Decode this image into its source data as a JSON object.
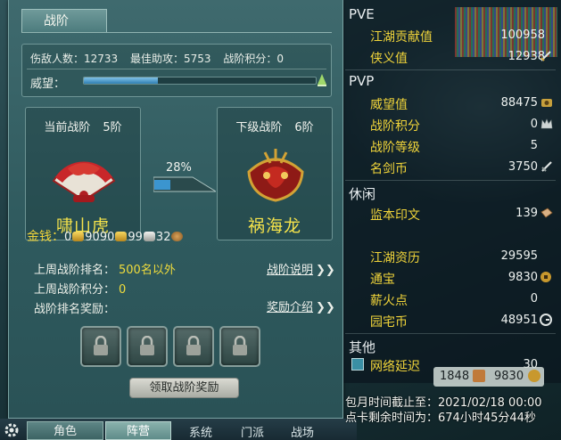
{
  "panel": {
    "tab_title": "战阶",
    "stats": {
      "kills": "伤敌人数：12733",
      "best_assist": "最佳助攻：5753",
      "points": "战阶积分：0"
    },
    "prestige_label": "威望：",
    "prestige_progress": 0.32,
    "current": {
      "header": "当前战阶",
      "rank": "5阶",
      "name": "啸山虎"
    },
    "next": {
      "header": "下级战阶",
      "rank": "6阶",
      "name": "祸海龙"
    },
    "progress_percent": "28%",
    "rows": {
      "last_week_rank_label": "上周战阶排名：",
      "last_week_rank_value": "500名以外",
      "last_week_points_label": "上周战阶积分：",
      "last_week_points_value": "0",
      "reward_label": "战阶排名奖励："
    },
    "links": {
      "description": "战阶说明",
      "rewards_intro": "奖励介绍"
    },
    "claim_button": "领取战阶奖励"
  },
  "bottom_tabs": {
    "character": "角色",
    "camp": "阵营",
    "system": "系统",
    "sect": "门派",
    "battlefield": "战场"
  },
  "right": {
    "pve_title": "PVE",
    "pve": [
      {
        "label": "江湖贡献值",
        "value": "100958"
      },
      {
        "label": "侠义值",
        "value": "12938"
      }
    ],
    "pvp_title": "PVP",
    "pvp": [
      {
        "label": "威望值",
        "value": "88475"
      },
      {
        "label": "战阶积分",
        "value": "0"
      },
      {
        "label": "战阶等级",
        "value": "5"
      },
      {
        "label": "名剑币",
        "value": "3750"
      }
    ],
    "leisure_title": "休闲",
    "leisure_first": {
      "label": "监本印文",
      "value": "139"
    },
    "money": {
      "label": "金钱：",
      "gold_brick": "0",
      "gold": "9090",
      "silver": "99",
      "copper": "32"
    },
    "leisure": [
      {
        "label": "江湖资历",
        "value": "29595"
      },
      {
        "label": "通宝",
        "value": "9830"
      },
      {
        "label": "薪火点",
        "value": "0"
      },
      {
        "label": "园宅币",
        "value": "48951"
      }
    ],
    "other_title": "其他",
    "other_first": {
      "label": "网络延迟",
      "value": "30"
    }
  },
  "currency_strip": {
    "left": "1848",
    "right": "9830"
  },
  "footer": {
    "expire": "包月时间截止至：2021/02/18 00:00",
    "remaining": "点卡剩余时间为：674小时45分44秒"
  },
  "colors": {
    "highlight": "#f0d43a",
    "panel": "#2f5a5e",
    "fill": "#2f7fb2"
  }
}
